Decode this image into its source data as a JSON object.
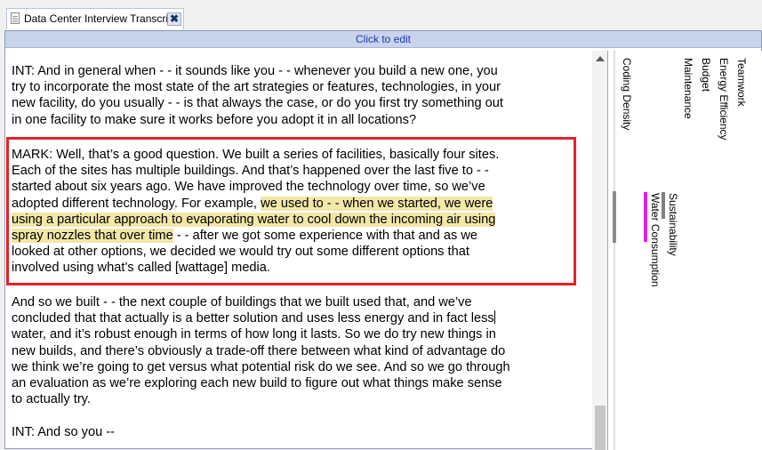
{
  "tab": {
    "title": "Data Center Interview Transcript",
    "close_glyph": "✖"
  },
  "edit_bar": {
    "label": "Click to edit"
  },
  "transcript": {
    "p1": [
      "INT:  And in general when - - it sounds like you - - whenever you build a new one, you",
      "try to incorporate the most state of the art strategies or features, technologies, in your",
      "new facility, do you usually - - is that always the case, or do you first try something out",
      "in one facility to make sure it works before you adopt it in all locations?"
    ],
    "p2": {
      "line1": "MARK:  Well, that’s a good question.  We built a series of facilities, basically four sites.",
      "line2": "Each of the sites has multiple buildings.  And that’s happened over the last five to - -",
      "line3": "started about six years ago.  We have improved the technology over time, so we’ve",
      "line4a": "adopted different technology.  For example, ",
      "line4b": "we used to - - when we started, we were",
      "line5": "using a particular approach to evaporating water to cool down the incoming air using",
      "line6a": "spray nozzles that over time",
      "line6b": " - - after we got some experience with that and as we",
      "line7": "looked at other options, we decided we would try out some different options that",
      "line8": "involved using what’s called [wattage] media."
    },
    "p3": [
      "And so we built - - the next couple of buildings that we built used that, and we’ve",
      "concluded that that actually is a better solution and uses less energy and in fact less",
      "water, and it’s robust enough in terms of how long it lasts.  So we do try new things in",
      "new builds, and there’s obviously a trade-off there between what kind of advantage do",
      "we think we’re going to get versus what potential risk do we see.  And so we go through",
      "an evaluation as we’re exploring each new build to figure out what things make sense",
      "to actually try."
    ],
    "p4": "INT:  And so you  --"
  },
  "coding_stripes": {
    "labels": [
      "Coding Density",
      "Maintenance",
      "Budget",
      "Energy Efficiency",
      "Teamwork",
      "Water Consumption",
      "Sustainability"
    ],
    "colors": {
      "water": "#e020e0",
      "sustainability": "#808080",
      "highlight": "#f1e7a8",
      "red_box": "#e3222a",
      "edit_bar_bg": "#c7d4ec"
    }
  }
}
